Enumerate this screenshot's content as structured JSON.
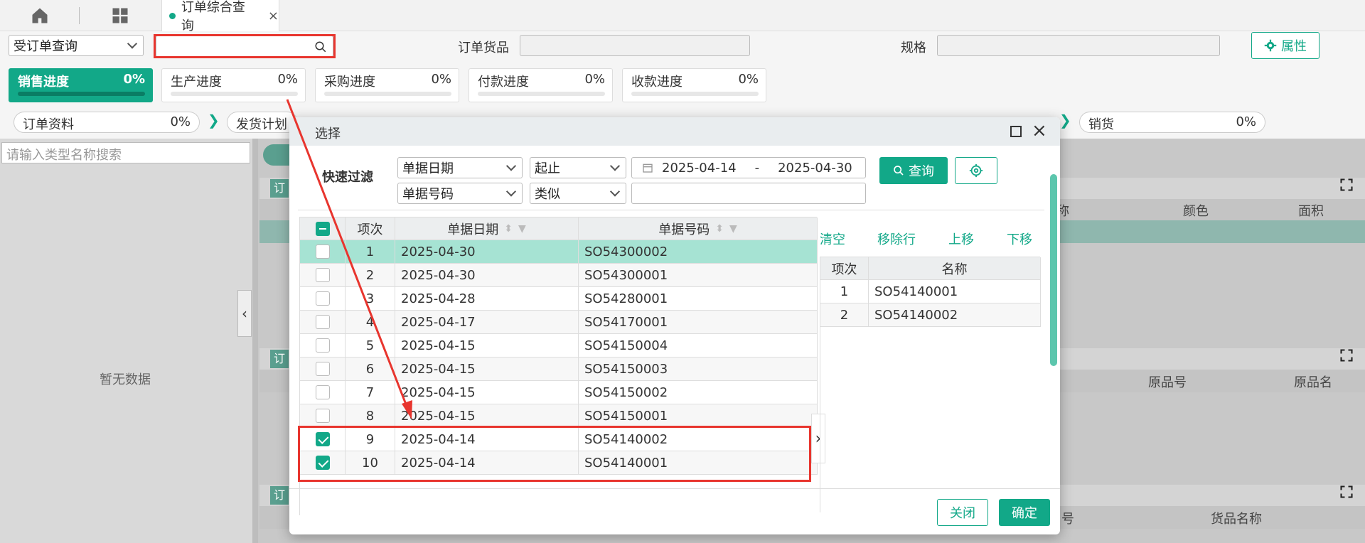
{
  "topbar": {
    "tab_label": "订单综合查询",
    "tab_close": "×"
  },
  "toolbar": {
    "query_type": "受订单查询",
    "goods_label": "订单货品",
    "spec_label": "规格",
    "attr_button": "属性"
  },
  "progress": [
    {
      "name": "销售进度",
      "value": "0%"
    },
    {
      "name": "生产进度",
      "value": "0%"
    },
    {
      "name": "采购进度",
      "value": "0%"
    },
    {
      "name": "付款进度",
      "value": "0%"
    },
    {
      "name": "收款进度",
      "value": "0%"
    }
  ],
  "steps": [
    {
      "name": "订单资料",
      "value": "0%"
    },
    {
      "name": "发货计划",
      "value": ""
    },
    {
      "name": "销货",
      "value": "0%"
    }
  ],
  "left": {
    "search_placeholder": "请输入类型名称搜索",
    "empty_text": "暂无数据"
  },
  "background_grid": {
    "s1_headers": [
      "称",
      "颜色",
      "面积"
    ],
    "s2_headers": [
      "原品号",
      "原品名"
    ],
    "s3_headers": [
      "号",
      "货品名称"
    ],
    "section_tag": "订"
  },
  "dialog": {
    "title": "选择",
    "filter_label": "快速过滤",
    "filter1_field": "单据日期",
    "filter1_op": "起止",
    "date_from": "2025-04-14",
    "date_sep": "-",
    "date_to": "2025-04-30",
    "filter2_field": "单据号码",
    "filter2_op": "类似",
    "filter2_value": "",
    "query_button": "查询",
    "columns": [
      "项次",
      "单据日期",
      "单据号码"
    ],
    "rows": [
      {
        "idx": "1",
        "date": "2025-04-30",
        "no": "SO54300002",
        "checked": false,
        "highlight": true
      },
      {
        "idx": "2",
        "date": "2025-04-30",
        "no": "SO54300001",
        "checked": false
      },
      {
        "idx": "3",
        "date": "2025-04-28",
        "no": "SO54280001",
        "checked": false
      },
      {
        "idx": "4",
        "date": "2025-04-17",
        "no": "SO54170001",
        "checked": false
      },
      {
        "idx": "5",
        "date": "2025-04-15",
        "no": "SO54150004",
        "checked": false
      },
      {
        "idx": "6",
        "date": "2025-04-15",
        "no": "SO54150003",
        "checked": false
      },
      {
        "idx": "7",
        "date": "2025-04-15",
        "no": "SO54150002",
        "checked": false
      },
      {
        "idx": "8",
        "date": "2025-04-15",
        "no": "SO54150001",
        "checked": false
      },
      {
        "idx": "9",
        "date": "2025-04-14",
        "no": "SO54140002",
        "checked": true
      },
      {
        "idx": "10",
        "date": "2025-04-14",
        "no": "SO54140001",
        "checked": true
      }
    ],
    "right_actions": [
      "清空",
      "移除行",
      "上移",
      "下移"
    ],
    "right_columns": [
      "项次",
      "名称"
    ],
    "right_rows": [
      {
        "idx": "1",
        "name": "SO54140001"
      },
      {
        "idx": "2",
        "name": "SO54140002"
      }
    ],
    "close_button": "关闭",
    "ok_button": "确定"
  },
  "colors": {
    "accent": "#12a888",
    "annotation": "#e8352e"
  }
}
